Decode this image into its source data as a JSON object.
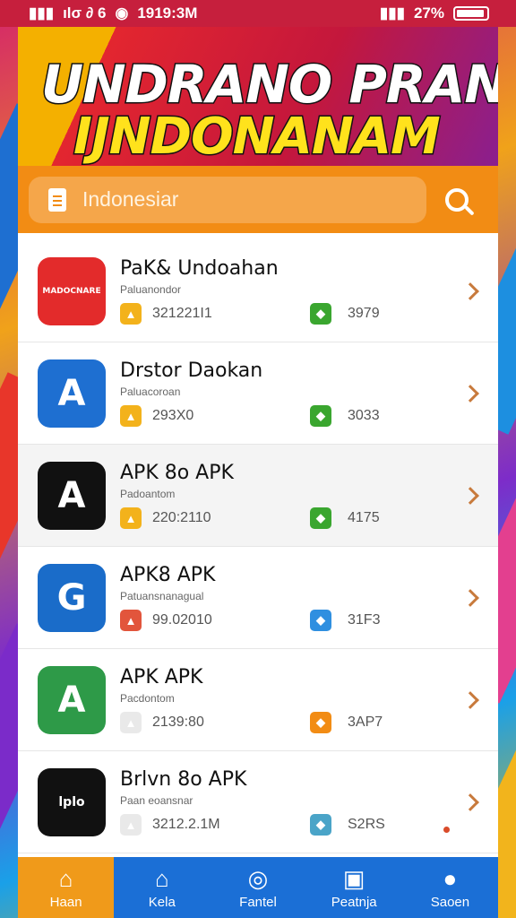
{
  "status_bar": {
    "left_text": "ılσ ∂ 6",
    "time": "1919:3M",
    "battery": "27%"
  },
  "banner": {
    "line1": "UNDRANO PRAN",
    "line2": "IJNDONANAM"
  },
  "search": {
    "placeholder": "Indonesiar"
  },
  "apps": [
    {
      "name": "PaK& Undoahan",
      "sub": "Paluanondor",
      "downloads": "321221I1",
      "rating": "3979",
      "icon_text": "MADOCNARE",
      "icon_bg": "#e32b2b",
      "mini_left": "#f3b21b",
      "mini_right": "#3aa62f",
      "icon_name": "red-badge-icon"
    },
    {
      "name": "Drstor Daokan",
      "sub": "Paluacoroan",
      "downloads": "293X0",
      "rating": "3033",
      "icon_text": "A",
      "icon_bg": "#1e6fd1",
      "mini_left": "#f3b21b",
      "mini_right": "#3aa62f",
      "icon_name": "blue-a-icon"
    },
    {
      "name": "APK 8o APK",
      "sub": "Padoantom",
      "downloads": "220:2110",
      "rating": "4175",
      "icon_text": "A",
      "icon_bg": "#111111",
      "mini_left": "#f3b21b",
      "mini_right": "#3aa62f",
      "icon_name": "black-a-icon"
    },
    {
      "name": "APK8 APK",
      "sub": "Patuansnanagual",
      "downloads": "99.02010",
      "rating": "31F3",
      "icon_text": "G",
      "icon_bg": "#1a6cc9",
      "mini_left": "#e2553c",
      "mini_right": "#2f8fe0",
      "icon_name": "blue-flag-icon"
    },
    {
      "name": "APK APK",
      "sub": "Pacdontom",
      "downloads": "2139:80",
      "rating": "3AP7",
      "icon_text": "A",
      "icon_bg": "#2e9a48",
      "mini_left": "#e9e9e9",
      "mini_right": "#f28c14",
      "icon_name": "green-a-icon"
    },
    {
      "name": "Brlvn 8o APK",
      "sub": "Paan eoansnar",
      "downloads": "3212.2.1M",
      "rating": "S2RS",
      "icon_text": "lplo",
      "icon_bg": "#111111",
      "mini_left": "#e9e9e9",
      "mini_right": "#4aa4c8",
      "icon_name": "black-red-a-icon"
    }
  ],
  "nav": [
    {
      "label": "Haan",
      "glyph": "⌂",
      "icon": "home-icon"
    },
    {
      "label": "Kela",
      "glyph": "⌂",
      "icon": "house-icon"
    },
    {
      "label": "Fantel",
      "glyph": "◎",
      "icon": "compass-icon"
    },
    {
      "label": "Peatnja",
      "glyph": "▣",
      "icon": "grid-icon"
    },
    {
      "label": "Saoen",
      "glyph": "●",
      "icon": "user-icon"
    }
  ]
}
